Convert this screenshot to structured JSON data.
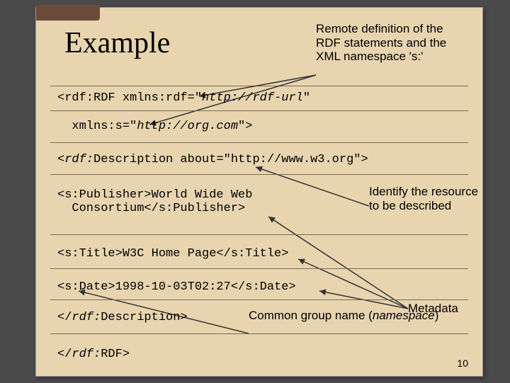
{
  "slide": {
    "title": "Example",
    "pageNumber": "10"
  },
  "annotations": {
    "remoteDef": "Remote definition of\nthe RDF statements\nand the XML\nnamespace 's:'",
    "identify": "Identify the\nresource\nto be described",
    "metadata": "Metadata",
    "common": "Common\ngroup name\n(namespace)"
  },
  "code": {
    "l1a": "<rdf:RDF xmlns:rdf=\"",
    "l1b": "http://rdf-url",
    "l1c": "\"",
    "l2a": "  xmlns:s=\"",
    "l2b": "http://org.com",
    "l2c": "\">",
    "l3a": "<",
    "l3b": "rdf:",
    "l3c": "Description about=\"http://www.w3.org\">",
    "l4": "<s:Publisher>World Wide Web\n  Consortium</s:Publisher>",
    "l5": "<s:Title>W3C Home Page</s:Title>",
    "l6": "<s:Date>1998-10-03T02:27</s:Date>",
    "l7a": "</",
    "l7b": "rdf:",
    "l7c": "Description>",
    "l8a": "</",
    "l8b": "rdf:",
    "l8c": "RDF>"
  }
}
